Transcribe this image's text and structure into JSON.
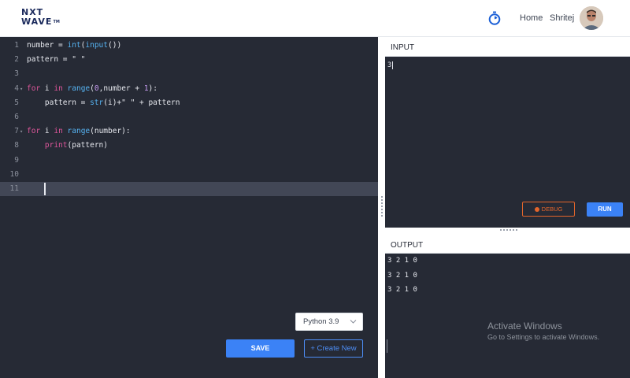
{
  "header": {
    "logo_line1": "NXT",
    "logo_line2": "WAVE",
    "logo_tm": "TM",
    "nav_home": "Home",
    "user_name": "Shritej"
  },
  "editor": {
    "lines": [
      {
        "num": "1",
        "fold": "",
        "tokens": [
          {
            "t": "number = ",
            "c": ""
          },
          {
            "t": "int",
            "c": "fn"
          },
          {
            "t": "(",
            "c": ""
          },
          {
            "t": "input",
            "c": "fn"
          },
          {
            "t": "())",
            "c": ""
          }
        ]
      },
      {
        "num": "2",
        "fold": "",
        "tokens": [
          {
            "t": "pattern = ",
            "c": ""
          },
          {
            "t": "\" \"",
            "c": "str"
          }
        ]
      },
      {
        "num": "3",
        "fold": "",
        "tokens": []
      },
      {
        "num": "4",
        "fold": "▾",
        "tokens": [
          {
            "t": "for",
            "c": "kw"
          },
          {
            "t": " i ",
            "c": ""
          },
          {
            "t": "in",
            "c": "kw"
          },
          {
            "t": " ",
            "c": ""
          },
          {
            "t": "range",
            "c": "fn"
          },
          {
            "t": "(",
            "c": ""
          },
          {
            "t": "0",
            "c": "num"
          },
          {
            "t": ",number + ",
            "c": ""
          },
          {
            "t": "1",
            "c": "num"
          },
          {
            "t": "):",
            "c": ""
          }
        ]
      },
      {
        "num": "5",
        "fold": "",
        "tokens": [
          {
            "t": "    pattern = ",
            "c": ""
          },
          {
            "t": "str",
            "c": "fn"
          },
          {
            "t": "(i)+\" \" + pattern",
            "c": ""
          }
        ]
      },
      {
        "num": "6",
        "fold": "",
        "tokens": []
      },
      {
        "num": "7",
        "fold": "▾",
        "tokens": [
          {
            "t": "for",
            "c": "kw"
          },
          {
            "t": " i ",
            "c": ""
          },
          {
            "t": "in",
            "c": "kw"
          },
          {
            "t": " ",
            "c": ""
          },
          {
            "t": "range",
            "c": "fn"
          },
          {
            "t": "(number):",
            "c": ""
          }
        ]
      },
      {
        "num": "8",
        "fold": "",
        "tokens": [
          {
            "t": "    ",
            "c": ""
          },
          {
            "t": "print",
            "c": "kw"
          },
          {
            "t": "(pattern)",
            "c": ""
          }
        ]
      },
      {
        "num": "9",
        "fold": "",
        "tokens": []
      },
      {
        "num": "10",
        "fold": "",
        "tokens": []
      },
      {
        "num": "11",
        "fold": "",
        "tokens": [],
        "active": true
      }
    ],
    "language": "Python 3.9",
    "save_label": "SAVE",
    "create_label": "+ Create New"
  },
  "input": {
    "title": "INPUT",
    "value": "3",
    "debug_label": "DEBUG",
    "run_label": "RUN"
  },
  "output": {
    "title": "OUTPUT",
    "lines": [
      "3 2 1 0",
      "3 2 1 0",
      "3 2 1 0"
    ]
  },
  "watermark": {
    "title": "Activate Windows",
    "subtitle": "Go to Settings to activate Windows."
  },
  "colors": {
    "editor_bg": "#262a35",
    "accent": "#3b82f6",
    "debug": "#e4652b",
    "keyword": "#e0579c",
    "function": "#56b3f2",
    "number": "#c79cf2"
  }
}
